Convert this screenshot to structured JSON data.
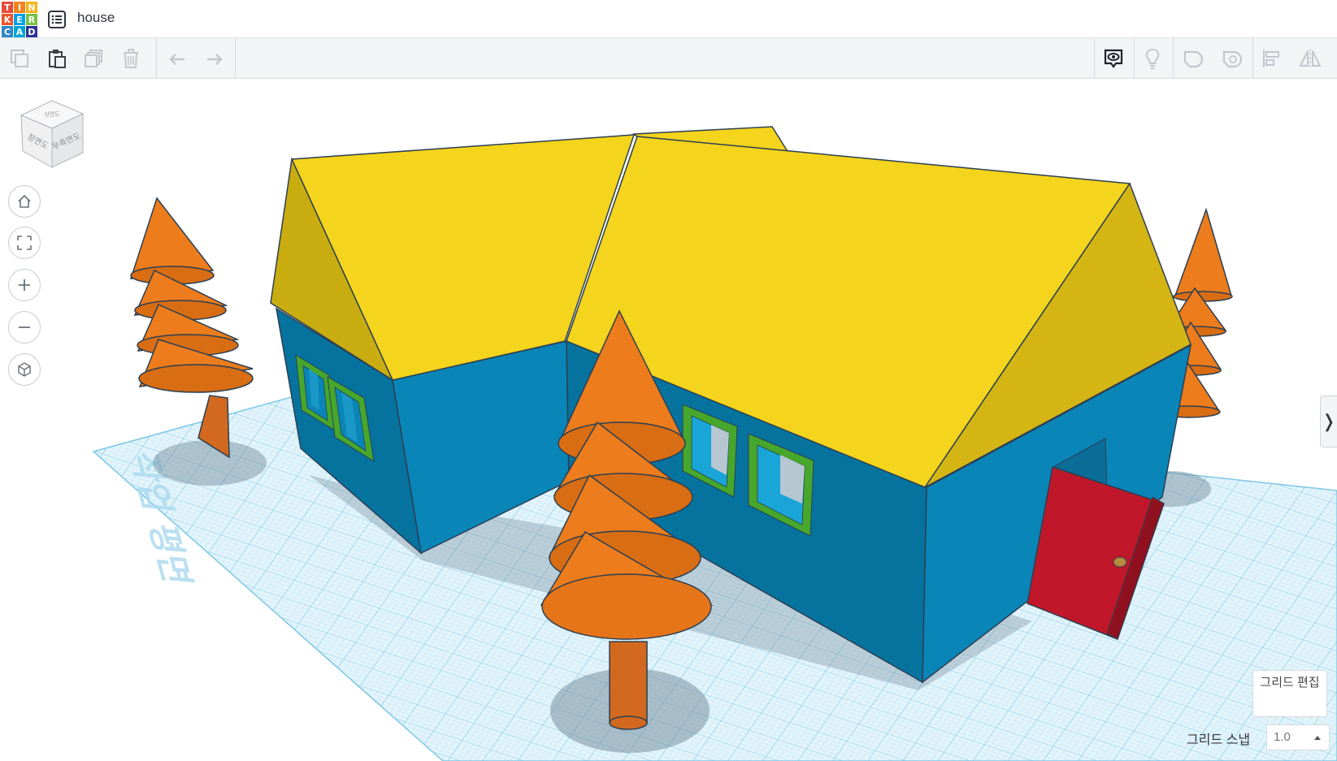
{
  "app": {
    "logo_letters": [
      "T",
      "I",
      "N",
      "K",
      "E",
      "R",
      "C",
      "A",
      "D"
    ],
    "logo_colors": [
      "#e94a3a",
      "#f58220",
      "#f6b318",
      "#e9542a",
      "#00a1e4",
      "#7ac143",
      "#2e86c8",
      "#00a4d6",
      "#2e3192"
    ]
  },
  "header": {
    "title": "house",
    "menu_icon": "list-icon"
  },
  "toolbar": {
    "left_icons": [
      "copy-icon",
      "paste-icon",
      "duplicate-icon",
      "delete-icon",
      "undo-icon",
      "redo-icon"
    ],
    "right_icons": [
      "show-all-icon",
      "light-bulb-icon",
      "solid-shape-icon",
      "hole-shape-icon",
      "align-icon",
      "mirror-icon"
    ]
  },
  "view_cube": {
    "front_label": "정면도",
    "right_label": "우측면도",
    "top_label": "상면도"
  },
  "view_controls": [
    "home-icon",
    "fit-view-icon",
    "zoom-in-icon",
    "zoom-out-icon",
    "ortho-view-icon"
  ],
  "workplane": {
    "text": "작업 평면"
  },
  "grid": {
    "edit_label": "그리드 편집",
    "snap_label": "그리드 스냅",
    "snap_value": "1.0"
  },
  "colors": {
    "roof": "#f4d41c",
    "roof_shade": "#c9ad10",
    "walls": "#0a85b8",
    "walls_dark": "#06739f",
    "tree": "#ec7c1c",
    "trunk": "#d2691e",
    "window_frame": "#46a72c",
    "door": "#c0182a",
    "grid_line": "#8fd0ea",
    "grid_fill": "#ddf1fa"
  }
}
